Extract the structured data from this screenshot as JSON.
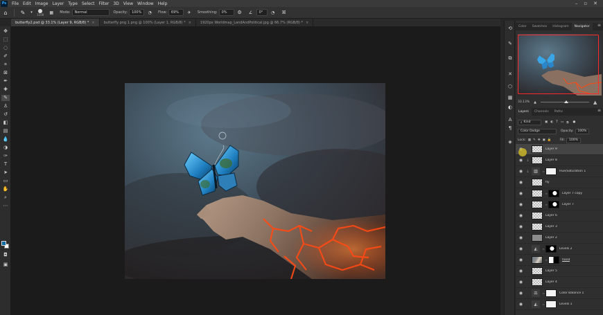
{
  "menu": [
    "File",
    "Edit",
    "Image",
    "Layer",
    "Type",
    "Select",
    "Filter",
    "3D",
    "View",
    "Window",
    "Help"
  ],
  "app_logo": "Ps",
  "options_bar": {
    "brush_size": "1100",
    "mode_label": "Mode:",
    "mode_value": "Normal",
    "opacity_label": "Opacity:",
    "opacity_value": "100%",
    "flow_label": "Flow:",
    "flow_value": "69%",
    "smoothing_label": "Smoothing:",
    "smoothing_value": "0%",
    "angle_value": "0°"
  },
  "tabs": [
    {
      "label": "butterfly2.psd @ 33.1% (Layer 9, RGB/8) *",
      "active": true
    },
    {
      "label": "butterfly png 1.png @ 100% (Layer 1, RGB/8) *",
      "active": false
    },
    {
      "label": "1920px Worldmap_LandAndPolitical.jpg @ 66.7% (RGB/8) *",
      "active": false
    }
  ],
  "top_panel_tabs": [
    "Color",
    "Swatches",
    "Histogram",
    "Navigator"
  ],
  "top_panel_active": "Navigator",
  "navigator": {
    "zoom": "33.13%"
  },
  "layers_tabs": [
    "Layers",
    "Channels",
    "Paths"
  ],
  "layers_active_tab": "Layers",
  "layers_filter": "Kind",
  "blend_mode": "Color Dodge",
  "opacity_label": "Opacity:",
  "opacity_value": "100%",
  "lock_label": "Lock:",
  "fill_label": "Fill:",
  "fill_value": "100%",
  "layers": [
    {
      "name": "Layer 9",
      "thumb": "checker",
      "selected": true
    },
    {
      "name": "Layer 8",
      "thumb": "checker",
      "selected": false
    },
    {
      "name": "Hue/Saturation 1",
      "thumb": "adj-hue",
      "mask": "white",
      "selected": false
    },
    {
      "name": "fly",
      "thumb": "checker",
      "selected": false
    },
    {
      "name": "Layer 7 copy",
      "thumb": "checker",
      "mask": "bw2",
      "selected": false
    },
    {
      "name": "Layer 7",
      "thumb": "checker",
      "mask": "bw2",
      "selected": false
    },
    {
      "name": "Layer 6",
      "thumb": "checker",
      "selected": false
    },
    {
      "name": "Layer 3",
      "thumb": "checker",
      "selected": false
    },
    {
      "name": "Layer 2",
      "thumb": "gray",
      "selected": false
    },
    {
      "name": "Levels 2",
      "thumb": "adj-levels",
      "mask": "bw2",
      "selected": false
    },
    {
      "name": "hand",
      "thumb": "photo",
      "mask": "blackwhite",
      "selected": false
    },
    {
      "name": "Layer 5",
      "thumb": "checker",
      "selected": false
    },
    {
      "name": "Layer 4",
      "thumb": "checker",
      "selected": false
    },
    {
      "name": "Color Balance 1",
      "thumb": "adj-balance",
      "mask": "white",
      "selected": false
    },
    {
      "name": "Levels 1",
      "thumb": "adj-levels",
      "mask": "white",
      "selected": false
    }
  ],
  "colors": {
    "foreground": "#0d6aa4",
    "background": "#ffffff",
    "navigator_frame": "#ff2b2b"
  },
  "icons": {
    "tools": [
      "move-icon",
      "marquee-icon",
      "lasso-icon",
      "quick-select-icon",
      "crop-icon",
      "frame-icon",
      "eyedropper-icon",
      "healing-icon",
      "brush-icon",
      "clone-stamp-icon",
      "history-brush-icon",
      "eraser-icon",
      "gradient-icon",
      "blur-icon",
      "dodge-icon",
      "pen-icon",
      "type-icon",
      "path-select-icon",
      "rectangle-icon",
      "hand-icon",
      "zoom-icon",
      "more-tools-icon"
    ]
  }
}
